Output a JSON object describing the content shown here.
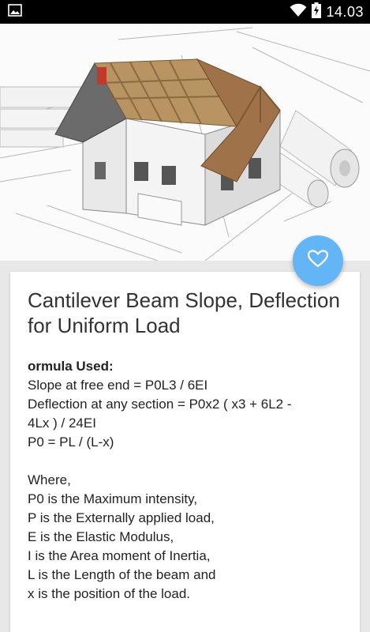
{
  "status_bar": {
    "time": "14.03",
    "icons": [
      "image-notification-icon",
      "wifi-icon",
      "battery-charging-icon"
    ]
  },
  "hero": {
    "image_description_icon": "house-blueprint-image"
  },
  "fab": {
    "icon": "heart-outline-icon",
    "color": "#64b5f6"
  },
  "card": {
    "title": "Cantilever Beam Slope, Deflection for Uniform Load",
    "formula_heading": "ormula Used:",
    "formula_lines": [
      "Slope at free end = P0L3 / 6EI",
      "Deflection at any section = P0x2 ( x3 + 6L2 -",
      "4Lx ) / 24EI",
      "P0 = PL / (L-x)"
    ],
    "where_label": "Where,",
    "definitions": [
      "P0 is the Maximum intensity,",
      "P is the Externally applied load,",
      "E is the Elastic Modulus,",
      "I is the Area moment of Inertia,",
      "L is the Length of the beam and",
      "x is the position of the load."
    ]
  }
}
